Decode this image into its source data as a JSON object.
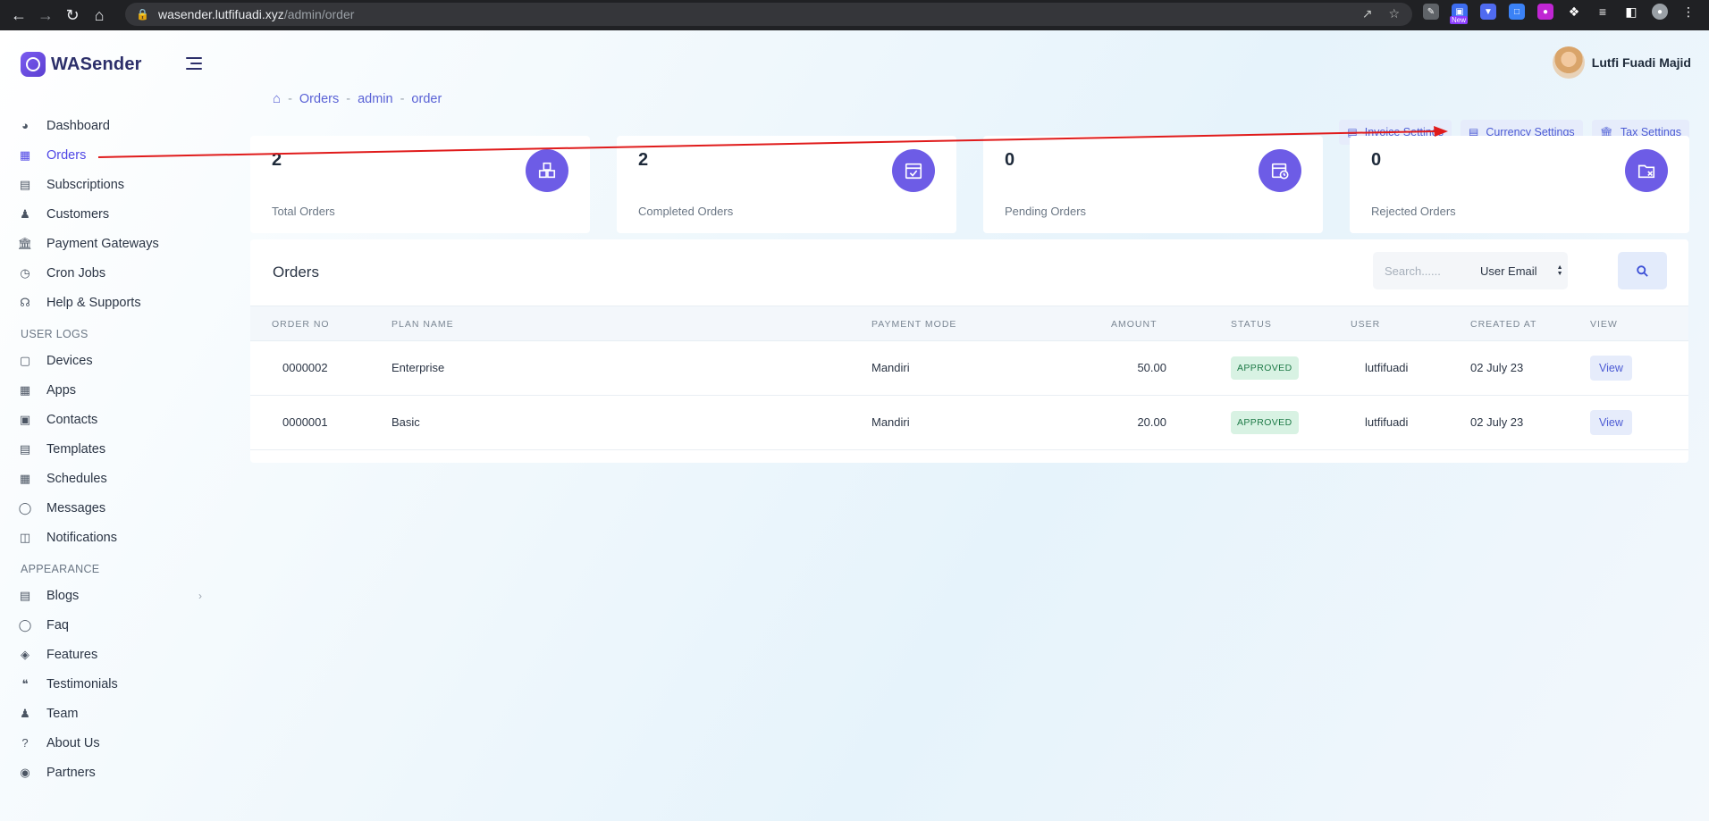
{
  "browser": {
    "url_host": "wasender.lutfifuadi.xyz",
    "url_path": "/admin/order",
    "ext_badge": "New"
  },
  "brand": {
    "name": "WASender"
  },
  "user": {
    "name": "Lutfi Fuadi Majid"
  },
  "sidebar": {
    "items_main": [
      {
        "label": "Dashboard",
        "icon": "gauge-icon"
      },
      {
        "label": "Orders",
        "icon": "boxes-icon",
        "active": true
      },
      {
        "label": "Subscriptions",
        "icon": "receipt-icon"
      },
      {
        "label": "Customers",
        "icon": "users-icon"
      },
      {
        "label": "Payment Gateways",
        "icon": "bank-icon"
      },
      {
        "label": "Cron Jobs",
        "icon": "calendar-clock-icon"
      },
      {
        "label": "Help & Supports",
        "icon": "headset-icon"
      }
    ],
    "section_logs": "USER LOGS",
    "items_logs": [
      {
        "label": "Devices",
        "icon": "devices-icon"
      },
      {
        "label": "Apps",
        "icon": "grid-icon"
      },
      {
        "label": "Contacts",
        "icon": "contact-icon"
      },
      {
        "label": "Templates",
        "icon": "template-icon"
      },
      {
        "label": "Schedules",
        "icon": "calendar-icon"
      },
      {
        "label": "Messages",
        "icon": "chat-icon"
      },
      {
        "label": "Notifications",
        "icon": "bell-icon"
      }
    ],
    "section_appearance": "APPEARANCE",
    "items_appearance": [
      {
        "label": "Blogs",
        "icon": "blog-icon",
        "has_children": true
      },
      {
        "label": "Faq",
        "icon": "faq-icon"
      },
      {
        "label": "Features",
        "icon": "tag-icon"
      },
      {
        "label": "Testimonials",
        "icon": "quote-icon"
      },
      {
        "label": "Team",
        "icon": "team-icon"
      },
      {
        "label": "About Us",
        "icon": "question-icon"
      },
      {
        "label": "Partners",
        "icon": "partners-icon"
      }
    ]
  },
  "breadcrumb": {
    "items": [
      "Orders",
      "admin",
      "order"
    ]
  },
  "actions": {
    "invoice": "Invoice Settings",
    "currency": "Currency Settings",
    "tax": "Tax Settings"
  },
  "stats": [
    {
      "value": "2",
      "label": "Total Orders",
      "icon": "boxes-icon"
    },
    {
      "value": "2",
      "label": "Completed Orders",
      "icon": "calendar-check-icon"
    },
    {
      "value": "0",
      "label": "Pending Orders",
      "icon": "calendar-clock-icon"
    },
    {
      "value": "0",
      "label": "Rejected Orders",
      "icon": "folder-x-icon"
    }
  ],
  "orders": {
    "title": "Orders",
    "search_placeholder": "Search......",
    "search_field": "User Email",
    "columns": [
      "ORDER NO",
      "PLAN NAME",
      "PAYMENT MODE",
      "AMOUNT",
      "STATUS",
      "USER",
      "CREATED AT",
      "VIEW"
    ],
    "rows": [
      {
        "order_no": "0000002",
        "plan": "Enterprise",
        "payment": "Mandiri",
        "amount": "50.00",
        "status": "APPROVED",
        "user": "lutfifuadi",
        "created": "02 July 23",
        "view": "View"
      },
      {
        "order_no": "0000001",
        "plan": "Basic",
        "payment": "Mandiri",
        "amount": "20.00",
        "status": "APPROVED",
        "user": "lutfifuadi",
        "created": "02 July 23",
        "view": "View"
      }
    ]
  },
  "colors": {
    "accent": "#6d5ce6",
    "link": "#5a62d6",
    "annotation": "#e01b1b",
    "approved_bg": "#d8f2e3"
  }
}
